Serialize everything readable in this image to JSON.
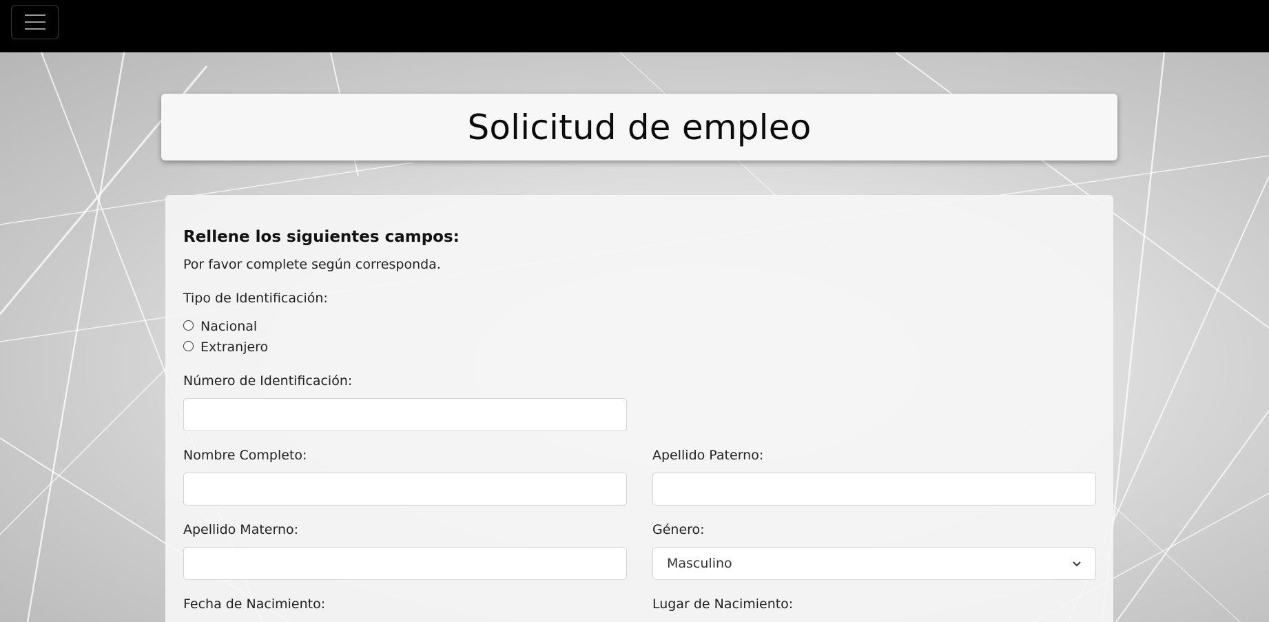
{
  "navbar": {
    "toggler_icon": "hamburger-menu-icon",
    "background": "#000000"
  },
  "page": {
    "title": "Solicitud de empleo"
  },
  "form": {
    "heading": "Rellene los siguientes campos:",
    "subheading": "Por favor complete según corresponda.",
    "id_type": {
      "label": "Tipo de Identificación:",
      "options": [
        "Nacional",
        "Extranjero"
      ]
    },
    "id_number": {
      "label": "Número de Identificación:",
      "value": ""
    },
    "full_name": {
      "label": "Nombre Completo:",
      "value": ""
    },
    "paternal_surname": {
      "label": "Apellido Paterno:",
      "value": ""
    },
    "maternal_surname": {
      "label": "Apellido Materno:",
      "value": ""
    },
    "gender": {
      "label": "Género:",
      "selected": "Masculino"
    },
    "birth_date": {
      "label": "Fecha de Nacimiento:"
    },
    "birth_place": {
      "label": "Lugar de Nacimiento:"
    }
  }
}
